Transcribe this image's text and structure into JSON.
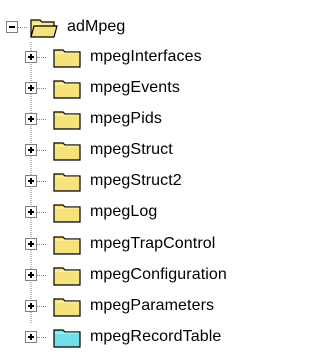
{
  "tree": {
    "root": {
      "label": "adMpeg",
      "expanded": true,
      "icon": "folder-open-icon",
      "icon_color": "#f5e27a"
    },
    "children": [
      {
        "label": "mpegInterfaces",
        "expanded": false,
        "icon": "folder-icon",
        "icon_color": "#f5e27a"
      },
      {
        "label": "mpegEvents",
        "expanded": false,
        "icon": "folder-icon",
        "icon_color": "#f5e27a"
      },
      {
        "label": "mpegPids",
        "expanded": false,
        "icon": "folder-icon",
        "icon_color": "#f5e27a"
      },
      {
        "label": "mpegStruct",
        "expanded": false,
        "icon": "folder-icon",
        "icon_color": "#f5e27a"
      },
      {
        "label": "mpegStruct2",
        "expanded": false,
        "icon": "folder-icon",
        "icon_color": "#f5e27a"
      },
      {
        "label": "mpegLog",
        "expanded": false,
        "icon": "folder-icon",
        "icon_color": "#f5e27a"
      },
      {
        "label": "mpegTrapControl",
        "expanded": false,
        "icon": "folder-icon",
        "icon_color": "#f5e27a"
      },
      {
        "label": "mpegConfiguration",
        "expanded": false,
        "icon": "folder-icon",
        "icon_color": "#f5e27a"
      },
      {
        "label": "mpegParameters",
        "expanded": false,
        "icon": "folder-icon",
        "icon_color": "#f5e27a"
      },
      {
        "label": "mpegRecordTable",
        "expanded": false,
        "icon": "table-icon",
        "icon_color": "#6fe0e6"
      }
    ]
  }
}
